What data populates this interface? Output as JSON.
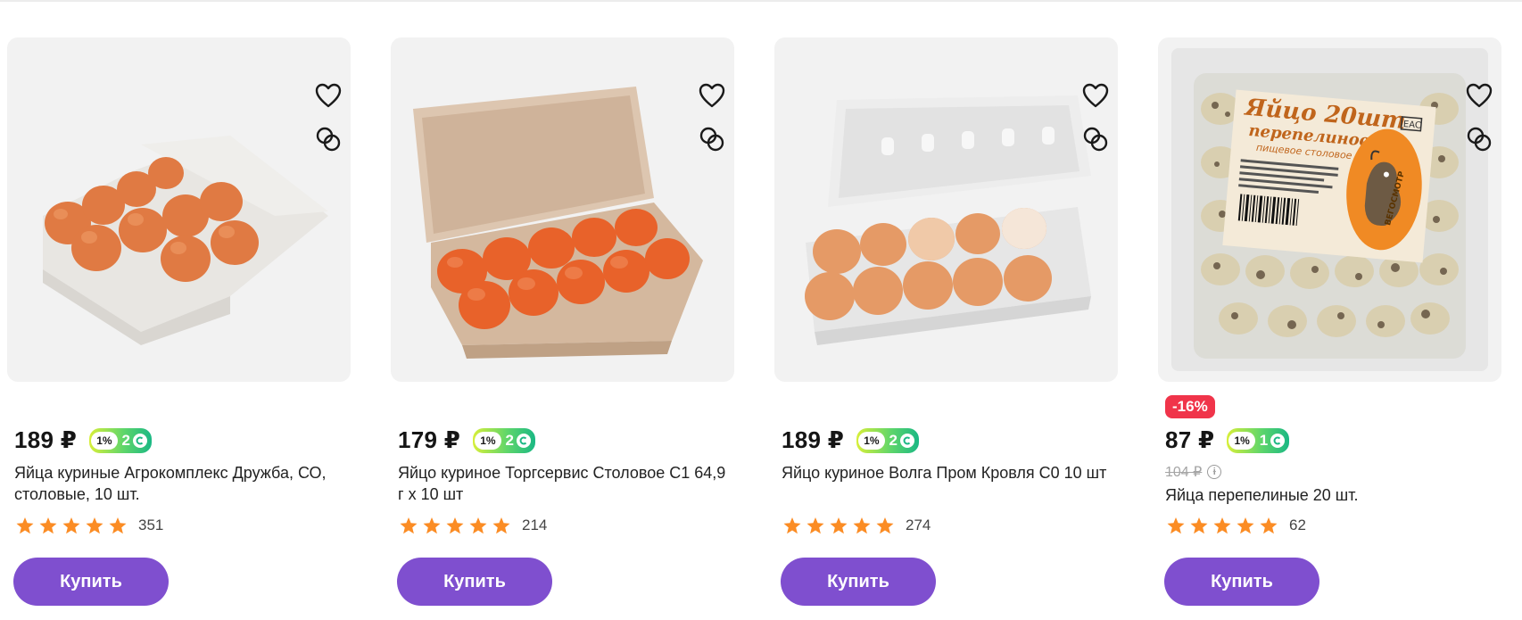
{
  "colors": {
    "accent": "#7f4fcf",
    "discount": "#f0344a",
    "star": "#fb8c24"
  },
  "icons": {
    "favorite": "heart-icon",
    "compare": "compare-icon",
    "info": "info-icon",
    "star": "star-icon",
    "coin": "coin-icon"
  },
  "products": [
    {
      "price": "189 ₽",
      "bonus_percent": "1%",
      "bonus_points": "2",
      "title": "Яйца куриные Агрокомплекс Дружба, СО, столовые, 10 шт.",
      "rating": 5,
      "reviews": "351",
      "buy_label": "Купить"
    },
    {
      "price": "179 ₽",
      "bonus_percent": "1%",
      "bonus_points": "2",
      "title": "Яйцо куриное Торгсервис Столовое С1 64,9 г х 10 шт",
      "rating": 5,
      "reviews": "214",
      "buy_label": "Купить"
    },
    {
      "price": "189 ₽",
      "bonus_percent": "1%",
      "bonus_points": "2",
      "title": "Яйцо куриное Волга Пром Кровля С0 10 шт",
      "rating": 5,
      "reviews": "274",
      "buy_label": "Купить"
    },
    {
      "discount": "-16%",
      "price": "87 ₽",
      "bonus_percent": "1%",
      "bonus_points": "1",
      "old_price": "104 ₽",
      "title": "Яйца перепелиные 20 шт.",
      "rating": 5,
      "reviews": "62",
      "buy_label": "Купить",
      "package_label": "Яйцо 20шт перепелиное пищевое столовое",
      "brand_logo_text": "ВЕГОСМОТР"
    }
  ]
}
